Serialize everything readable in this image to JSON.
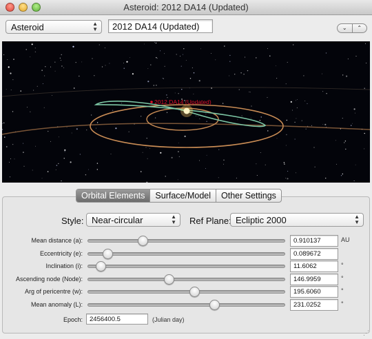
{
  "window": {
    "title": "Asteroid: 2012 DA14 (Updated)"
  },
  "toolbar": {
    "object_type": "Asteroid",
    "object_name": "2012 DA14 (Updated)"
  },
  "viewport": {
    "body_label": "2012 DA14 (Updated)",
    "colors": {
      "label": "#e0102a",
      "orbit_asteroid": "#7ec8a6",
      "orbit_planets": "#c98c55",
      "sun": "#ffd56a"
    }
  },
  "tabs": [
    "Orbital Elements",
    "Surface/Model",
    "Other Settings"
  ],
  "settings": {
    "style_label": "Style:",
    "style_value": "Near-circular",
    "refplane_label": "Ref Plane:",
    "refplane_value": "Ecliptic 2000"
  },
  "elements": [
    {
      "label": "Mean distance (a):",
      "value": "0.910137",
      "unit": "AU",
      "slider_fraction": 0.28
    },
    {
      "label": "Eccentricity (e):",
      "value": "0.089672",
      "unit": "",
      "slider_fraction": 0.1
    },
    {
      "label": "Inclination (i):",
      "value": "11.6062",
      "unit": "°",
      "slider_fraction": 0.065
    },
    {
      "label": "Ascending node (Node):",
      "value": "146.9959",
      "unit": "°",
      "slider_fraction": 0.41
    },
    {
      "label": "Arg of pericentre (w):",
      "value": "195.6060",
      "unit": "°",
      "slider_fraction": 0.54
    },
    {
      "label": "Mean anomaly (L):",
      "value": "231.0252",
      "unit": "°",
      "slider_fraction": 0.64
    }
  ],
  "epoch": {
    "label": "Epoch:",
    "value": "2456400.5",
    "unit": "(Julian day)"
  }
}
